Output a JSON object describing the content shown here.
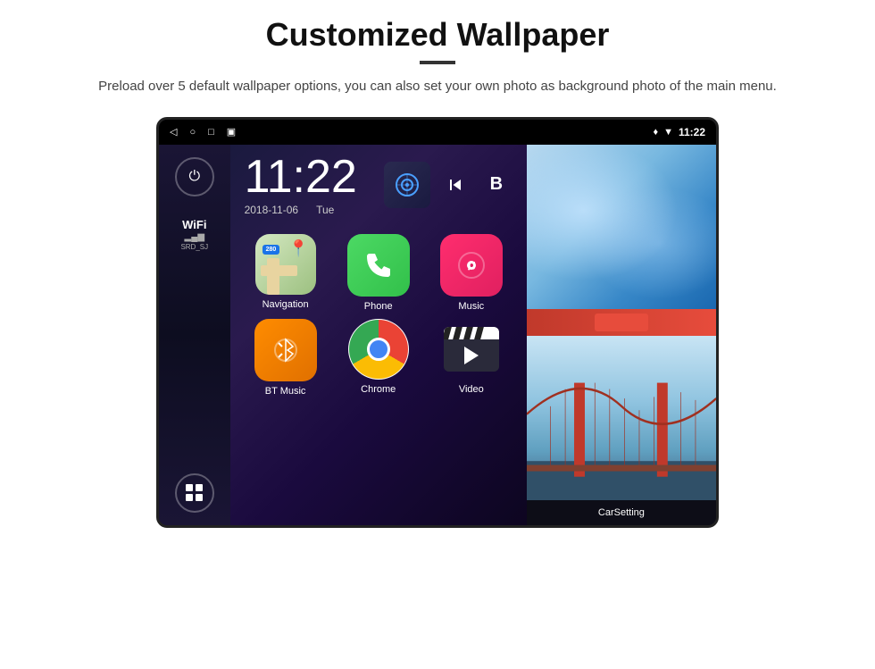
{
  "header": {
    "title": "Customized Wallpaper",
    "subtitle": "Preload over 5 default wallpaper options, you can also set your own photo as background photo of the main menu."
  },
  "device": {
    "statusBar": {
      "time": "11:22",
      "icons": [
        "◁",
        "○",
        "□",
        "▣",
        "♦",
        "▼"
      ]
    },
    "clock": {
      "time": "11:22",
      "date": "2018-11-06",
      "day": "Tue"
    },
    "sidebar": {
      "powerLabel": "⏻",
      "wifi": {
        "label": "WiFi",
        "bars": "▂▄▆",
        "ssid": "SRD_SJ"
      },
      "appsLabel": "⊞"
    },
    "apps": [
      {
        "name": "Navigation",
        "icon": "map"
      },
      {
        "name": "Phone",
        "icon": "phone"
      },
      {
        "name": "Music",
        "icon": "music"
      },
      {
        "name": "BT Music",
        "icon": "bluetooth"
      },
      {
        "name": "Chrome",
        "icon": "chrome"
      },
      {
        "name": "Video",
        "icon": "video"
      }
    ],
    "wallpapers": [
      {
        "name": "ice-blue",
        "label": ""
      },
      {
        "name": "golden-gate",
        "label": ""
      }
    ],
    "carSetting": {
      "label": "CarSetting"
    }
  }
}
